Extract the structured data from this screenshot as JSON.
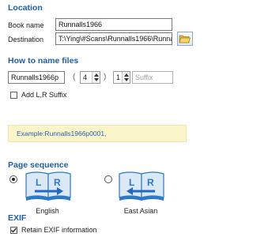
{
  "location": {
    "title": "Location",
    "book_name_label": "Book name",
    "book_name_value": "Runnalls1966",
    "destination_label": "Destination",
    "destination_value": "T:\\Ying\\#Scans\\Runnalls1966\\Runnall"
  },
  "naming": {
    "title": "How to name files",
    "prefix_value": "Runnalls1966p",
    "paren_open": "(",
    "digits_value": "4",
    "paren_close": ")",
    "start_value": "1",
    "suffix_placeholder": "Suffix",
    "add_lr_label": "Add L,R Suffix",
    "add_lr_checked": false,
    "example": "Example:Runnalls1966p0001,"
  },
  "page_sequence": {
    "title": "Page sequence",
    "options": [
      {
        "label": "English",
        "selected": true,
        "left_letter": "L",
        "right_letter": "R"
      },
      {
        "label": "East Asian",
        "selected": false,
        "left_letter": "L",
        "right_letter": "R"
      }
    ]
  },
  "exif": {
    "title": "EXIF",
    "retain_label": "Retain EXIF information",
    "retain_checked": true
  },
  "icons": {
    "folder": "folder-open-icon",
    "book": "book-icon",
    "arrow": "arrow-icon"
  },
  "colors": {
    "section_title": "#1c5fa8",
    "example_bg": "#fbf6c9",
    "example_text": "#2b5cab",
    "book_blue": "#2e79c7",
    "arrow_blue": "#2468c4"
  }
}
